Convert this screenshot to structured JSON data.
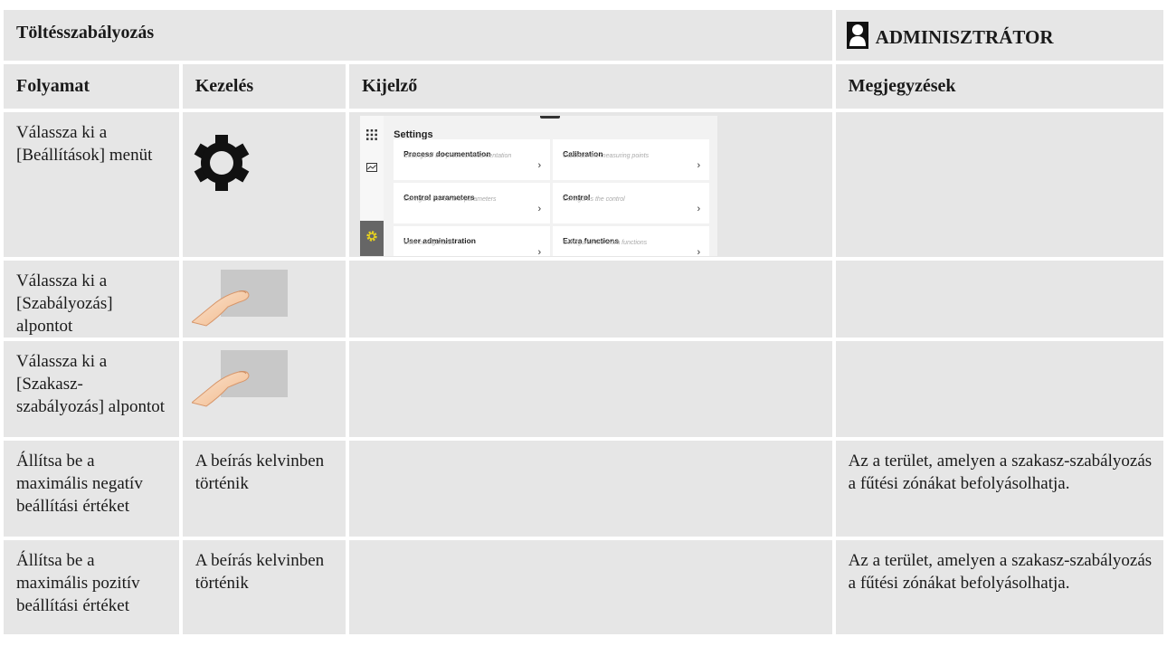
{
  "doc": {
    "title": "Töltésszabályozás",
    "role": "ADMINISZTRÁTOR",
    "role_icon": "user-icon"
  },
  "headers": [
    "Folyamat",
    "Kezelés",
    "Kijelző",
    "Megjegyzések"
  ],
  "rows": [
    {
      "process": "Válassza ki a [Beállítások] menüt",
      "operation_icon": "gear-icon"
    },
    {
      "process": "Válassza ki a [Szabályozás] alpontot",
      "operation_icon": "finger-touch-icon"
    },
    {
      "process": "Válassza ki a [Szakasz-szabályozás] alpontot",
      "operation_icon": "finger-touch-icon"
    },
    {
      "process": "Állítsa be a maximális negatív beállítási értéket",
      "operation": "A beírás kelvinben történik",
      "note": "Az a terület, amelyen a szakasz-szabályozás a fűtési zónákat befolyásolhatja."
    },
    {
      "process": "Állítsa be a maximális pozitív beállítási értéket",
      "operation": "A beírás kelvinben történik",
      "note": "Az a terület, amelyen a szakasz-szabályozás a fűtési zónákat befolyásolhatja."
    }
  ],
  "screenshot": {
    "title": "Settings",
    "tiles": [
      {
        "title": "Process documentation",
        "subtitle": "Settings of the process documentation"
      },
      {
        "title": "Calibration",
        "subtitle": "Calibrate the measuring points"
      },
      {
        "title": "Control parameters",
        "subtitle": "Configure the control parameters"
      },
      {
        "title": "Control",
        "subtitle": "Configures the control"
      },
      {
        "title": "User administration",
        "subtitle": "User configuration"
      },
      {
        "title": "Extra functions",
        "subtitle": "Configures the extra functions"
      }
    ],
    "arrow": "›",
    "sidebar_icons": [
      "apps-grid-icon",
      "chart-icon",
      "gear-icon"
    ],
    "accent_color": "#e8d21f"
  }
}
